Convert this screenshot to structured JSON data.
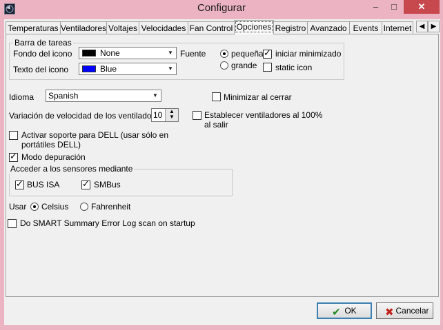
{
  "window": {
    "title": "Configurar",
    "minimize": "–",
    "maximize": "□",
    "close": "✕"
  },
  "tabs": [
    {
      "label": "Temperaturas"
    },
    {
      "label": "Ventiladores"
    },
    {
      "label": "Voltajes"
    },
    {
      "label": "Velocidades"
    },
    {
      "label": "Fan Control"
    },
    {
      "label": "Opciones"
    },
    {
      "label": "Registro"
    },
    {
      "label": "Avanzado"
    },
    {
      "label": "Events"
    },
    {
      "label": "Internet"
    }
  ],
  "active_tab": "Opciones",
  "taskbar_group": {
    "title": "Barra de tareas",
    "icon_bg_label": "Fondo del icono",
    "icon_bg_value": "None",
    "icon_bg_color": "#000000",
    "icon_text_label": "Texto del icono",
    "icon_text_value": "Blue",
    "icon_text_color": "#0000ff",
    "font_label": "Fuente",
    "font_small": "pequeña",
    "font_large": "grande",
    "start_minimized": "iniciar minimizado",
    "static_icon": "static icon"
  },
  "language": {
    "label": "Idioma",
    "value": "Spanish"
  },
  "minimize_on_close": "Minimizar al cerrar",
  "fan_speed": {
    "label": "Variación de velocidad de los ventiladores",
    "value": "10"
  },
  "fans_100": "Establecer ventiladores al 100% al salir",
  "dell_support": "Activar soporte para DELL (usar sólo en portátiles DELL)",
  "debug_mode": "Modo depuración",
  "sensors_group": {
    "title": "Acceder a los sensores mediante",
    "isa": "BUS ISA",
    "smbus": "SMBus"
  },
  "units": {
    "label": "Usar",
    "celsius": "Celsius",
    "fahrenheit": "Fahrenheit"
  },
  "smart_log": "Do SMART Summary Error Log scan on startup",
  "buttons": {
    "ok": "OK",
    "cancel": "Cancelar"
  }
}
